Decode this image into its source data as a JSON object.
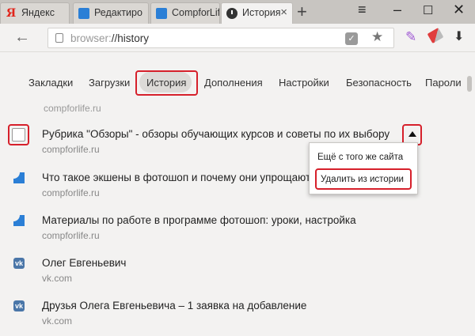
{
  "tabs": [
    {
      "label": "Яндекс",
      "icon": "yandex-icon"
    },
    {
      "label": "Редактиро",
      "icon": "compforlife-favicon"
    },
    {
      "label": "CompforLif",
      "icon": "compforlife-favicon"
    },
    {
      "label": "История",
      "icon": "history-clock-icon",
      "active": true
    }
  ],
  "address": {
    "scheme": "browser:",
    "path": "//history"
  },
  "nav": {
    "items": [
      "Закладки",
      "Загрузки",
      "История",
      "Дополнения",
      "Настройки",
      "Безопасность",
      "Пароли"
    ],
    "active": "История"
  },
  "history": {
    "cut_url": "compforlife.ru",
    "items": [
      {
        "title": "Рубрика \"Обзоры\" - обзоры обучающих курсов и советы по их выбору",
        "url": "compforlife.ru",
        "icon": "checkbox",
        "selected": true
      },
      {
        "title": "Что такое экшены в фотошоп и почему они упрощают работу в фотошопа",
        "url": "compforlife.ru",
        "icon": "compforlife-favicon"
      },
      {
        "title": "Материалы по работе в программе фотошоп: уроки, настройка",
        "url": "compforlife.ru",
        "icon": "compforlife-favicon"
      },
      {
        "title": "Олег Евгеньевич",
        "url": "vk.com",
        "icon": "vk-icon"
      },
      {
        "title": "Друзья Олега Евгеньевича – 1 заявка на добавление",
        "url": "vk.com",
        "icon": "vk-icon"
      }
    ]
  },
  "context_menu": {
    "items": [
      "Ещё с того же сайта",
      "Удалить из истории"
    ],
    "highlighted": "Удалить из истории"
  },
  "colors": {
    "highlight_red": "#d6202b",
    "accent_blue": "#2b7fd6",
    "vk_blue": "#4a76a8"
  }
}
